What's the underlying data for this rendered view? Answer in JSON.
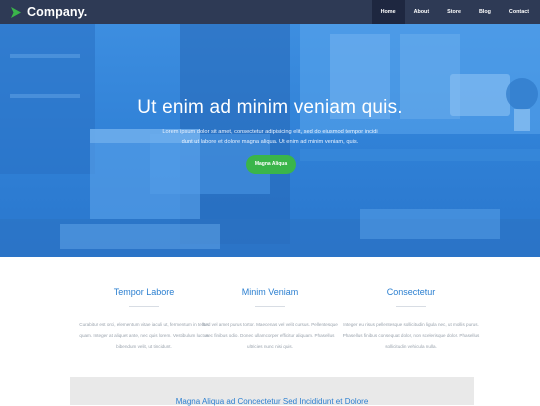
{
  "brand": {
    "name": "Company."
  },
  "nav": {
    "items": [
      "Home",
      "About",
      "Store",
      "Blog",
      "Contact"
    ],
    "active": "Home"
  },
  "hero": {
    "title": "Ut enim ad minim veniam quis.",
    "text_line1": "Lorem ipsum dolor sit amet, consectetur adipisicing elit, sed do eiusmod tempor incidi",
    "text_line2": "dunt ut labore et dolore magna aliqua. Ut enim ad minim veniam, quis.",
    "button": "Magna Aliqua"
  },
  "features": [
    {
      "title": "Tempor Labore",
      "text": "Curabitur est orci, elementum vitae iaculi ut, fermentum in tellus quam. Integer at aliquet ante, nec quis lorem. Vestibulum luctus bibendum velit, ut tincidunt."
    },
    {
      "title": "Minim Veniam",
      "text": "Sed vel amet purus tortor. Maecenas vel velit cursus. Pellentesque nec finibus odio. Donec ullamcorper efficitur aliquam. Phasellus ultricies nunc nisi quis."
    },
    {
      "title": "Consectetur",
      "text": "Integer eu risus pellentesque sollicitudin ligula nec, ut mollis purus. Phasellus finibus consequat dolor, non scelerisque dolor. Phasellus sollicitudin vehicula nulla."
    }
  ],
  "band": {
    "title": "Magna Aliqua ad Concectetur Sed Incididunt et Dolore"
  },
  "colors": {
    "header": "#2e3a55",
    "hero": "#2f80d6",
    "accent": "#2b7fd0",
    "button": "#3ab54a",
    "logo": "#3ab54a"
  }
}
